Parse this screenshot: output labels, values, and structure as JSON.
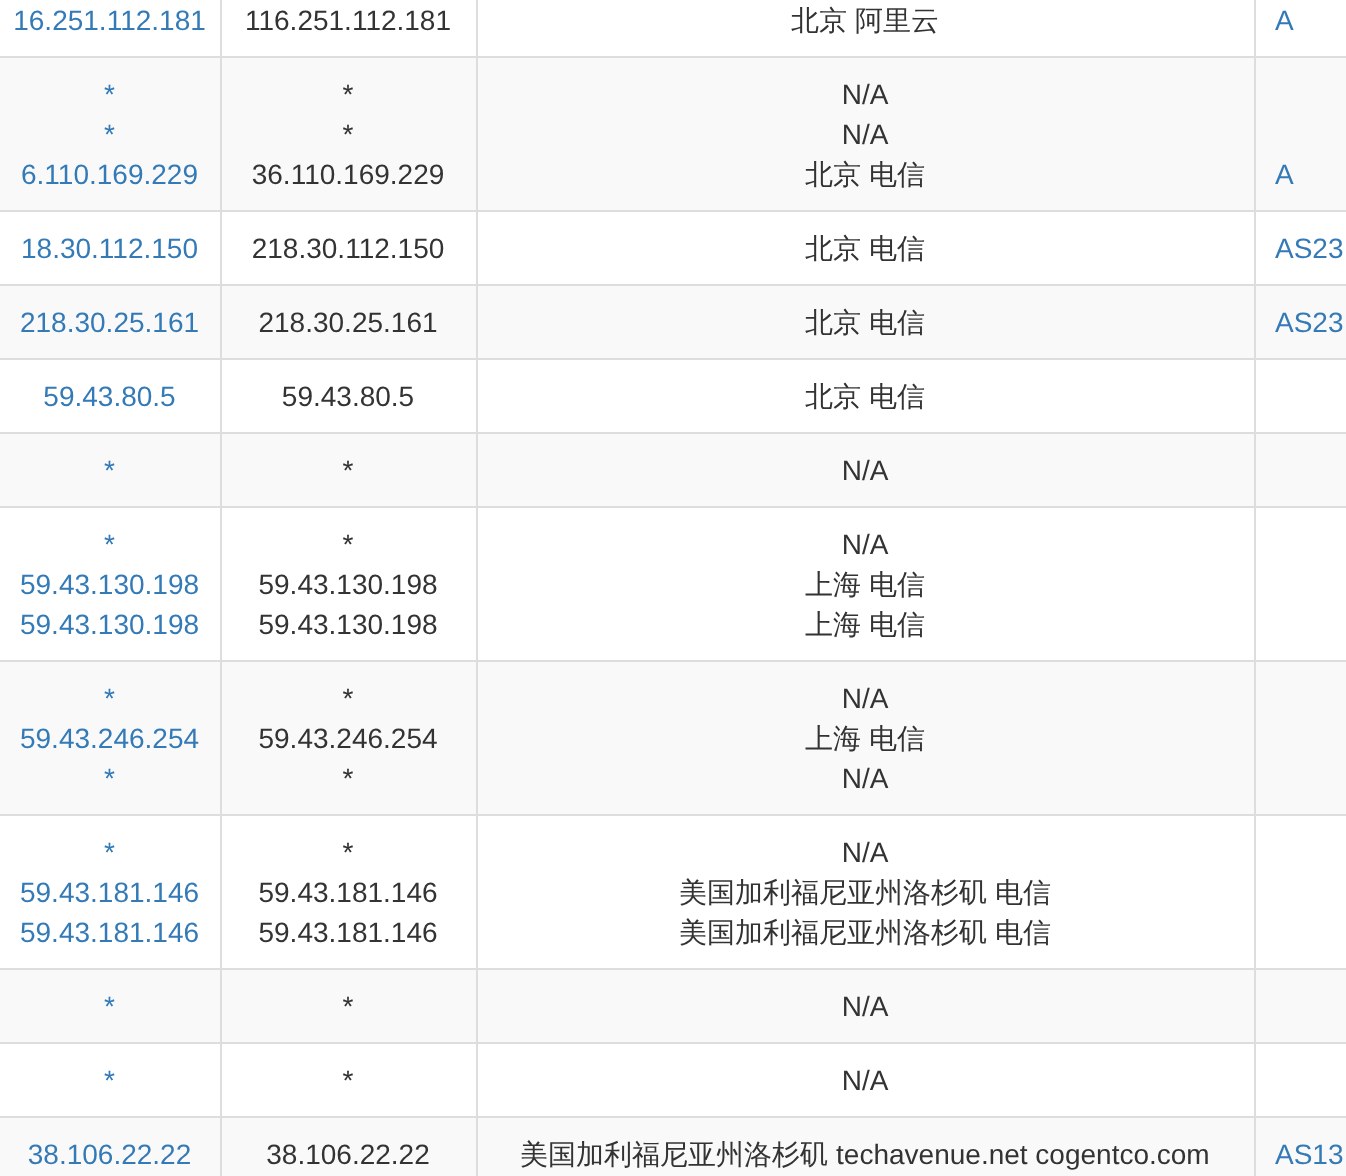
{
  "table": {
    "rows": [
      {
        "column_1": [
          "16.251.112.181"
        ],
        "column_2": [
          "116.251.112.181"
        ],
        "column_3": [
          "北京 阿里云"
        ],
        "column_4": "A"
      },
      {
        "column_1": [
          "*",
          "*",
          "6.110.169.229"
        ],
        "column_2": [
          "*",
          "*",
          "36.110.169.229"
        ],
        "column_3": [
          "N/A",
          "N/A",
          "北京 电信"
        ],
        "column_4": "A"
      },
      {
        "column_1": [
          "18.30.112.150"
        ],
        "column_2": [
          "218.30.112.150"
        ],
        "column_3": [
          "北京 电信"
        ],
        "column_4": "AS23"
      },
      {
        "column_1": [
          "218.30.25.161"
        ],
        "column_2": [
          "218.30.25.161"
        ],
        "column_3": [
          "北京 电信"
        ],
        "column_4": "AS23"
      },
      {
        "column_1": [
          "59.43.80.5"
        ],
        "column_2": [
          "59.43.80.5"
        ],
        "column_3": [
          "北京 电信"
        ]
      },
      {
        "column_1": [
          "*"
        ],
        "column_2": [
          "*"
        ],
        "column_3": [
          "N/A"
        ]
      },
      {
        "column_1": [
          "*",
          "59.43.130.198",
          "59.43.130.198"
        ],
        "column_2": [
          "*",
          "59.43.130.198",
          "59.43.130.198"
        ],
        "column_3": [
          "N/A",
          "上海 电信",
          "上海 电信"
        ]
      },
      {
        "column_1": [
          "*",
          "59.43.246.254",
          "*"
        ],
        "column_2": [
          "*",
          "59.43.246.254",
          "*"
        ],
        "column_3": [
          "N/A",
          "上海 电信",
          "N/A"
        ]
      },
      {
        "column_1": [
          "*",
          "59.43.181.146",
          "59.43.181.146"
        ],
        "column_2": [
          "*",
          "59.43.181.146",
          "59.43.181.146"
        ],
        "column_3": [
          "N/A",
          "美国加利福尼亚州洛杉矶 电信",
          "美国加利福尼亚州洛杉矶 电信"
        ]
      },
      {
        "column_1": [
          "*"
        ],
        "column_2": [
          "*"
        ],
        "column_3": [
          "N/A"
        ]
      },
      {
        "column_1": [
          "*"
        ],
        "column_2": [
          "*"
        ],
        "column_3": [
          "N/A"
        ]
      },
      {
        "column_1": [
          "38.106.22.22"
        ],
        "column_2": [
          "38.106.22.22"
        ],
        "column_3": [
          "美国加利福尼亚州洛杉矶 techavenue.net cogentco.com"
        ],
        "column_4": "AS13"
      }
    ]
  }
}
